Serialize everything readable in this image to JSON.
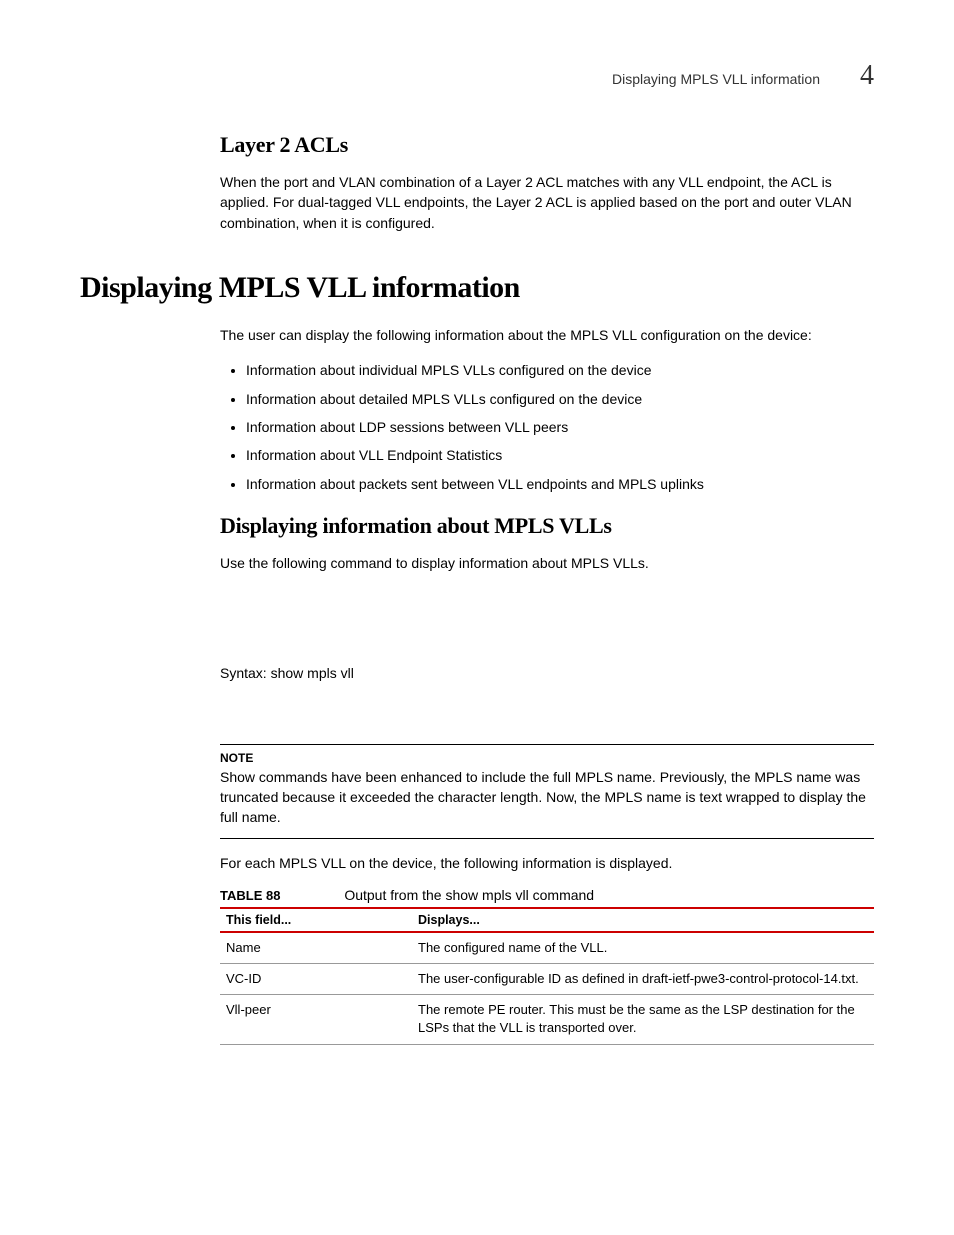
{
  "header": {
    "running_title": "Displaying MPLS VLL information",
    "chapter_number": "4"
  },
  "section_layer2": {
    "heading": "Layer 2 ACLs",
    "para": "When the port and VLAN combination of a Layer 2 ACL matches with any VLL endpoint, the ACL is applied. For dual-tagged VLL endpoints, the Layer 2 ACL is applied based on the port and outer VLAN combination, when it is configured."
  },
  "section_display": {
    "heading": "Displaying MPLS VLL information",
    "intro": "The user can display the following information about the MPLS VLL configuration on the device:",
    "bullets": [
      "Information about individual MPLS VLLs configured on the device",
      "Information about detailed MPLS VLLs configured on the device",
      "Information about LDP sessions between VLL peers",
      "Information about VLL Endpoint Statistics",
      "Information about packets sent between VLL endpoints and MPLS uplinks"
    ]
  },
  "section_info": {
    "heading": "Displaying information about MPLS VLLs",
    "para": "Use the following command to display information about MPLS VLLs.",
    "syntax": "Syntax:  show mpls vll"
  },
  "note": {
    "label": "NOTE",
    "text": "Show commands have been enhanced to include the full MPLS name. Previously, the MPLS name was truncated because it exceeded the character length. Now, the MPLS name is text wrapped to display the full name."
  },
  "after_note": "For each MPLS VLL on the device, the following information is displayed.",
  "table": {
    "number": "TABLE 88",
    "caption": "Output from the show mpls vll command",
    "head_field": "This field...",
    "head_displays": "Displays...",
    "rows": [
      {
        "field": "Name",
        "displays": "The configured name of the VLL."
      },
      {
        "field": "VC-ID",
        "displays": "The user-configurable ID as defined in draft-ietf-pwe3-control-protocol-14.txt."
      },
      {
        "field": "Vll-peer",
        "displays": "The remote PE router. This must be the same as the LSP destination for the LSPs that the VLL is transported over."
      }
    ]
  }
}
